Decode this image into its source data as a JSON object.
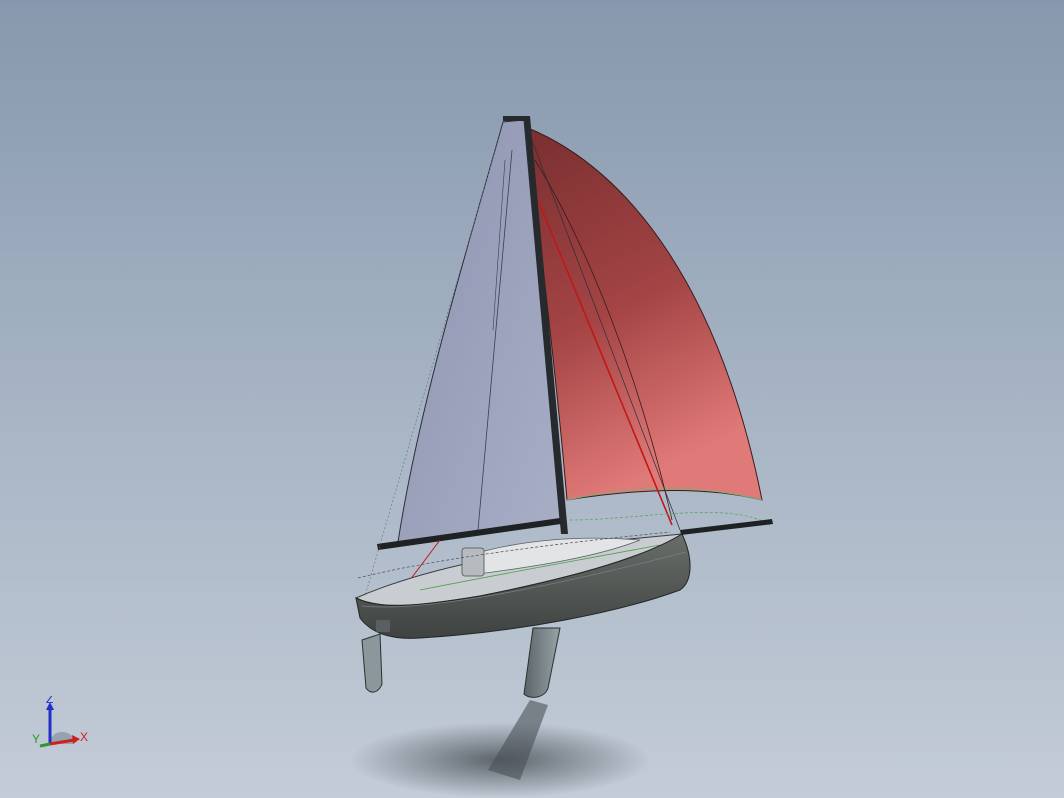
{
  "viewport": {
    "background_top": "#8798ad",
    "background_bottom": "#c3ccd7"
  },
  "model": {
    "hull_color": "#505553",
    "mainsail_color": "#9da3bd",
    "spinnaker_color": "#b34a4c",
    "appendage_color": "#7e8a8e"
  },
  "triad": {
    "z_label": "Z",
    "x_label": "X",
    "y_label": "Y",
    "x_color": "#d0201e",
    "y_color": "#2a9a2a",
    "z_color": "#2030c8"
  }
}
